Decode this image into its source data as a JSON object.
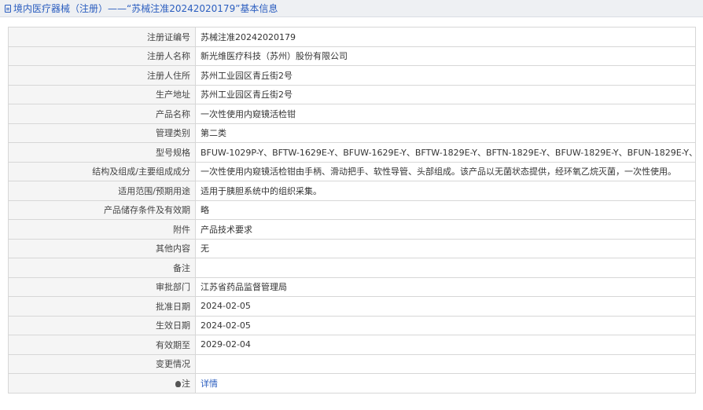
{
  "header": {
    "title": "境内医疗器械（注册）——“苏械注准20242020179”基本信息"
  },
  "rows": [
    {
      "label": "注册证编号",
      "value": "苏械注准20242020179"
    },
    {
      "label": "注册人名称",
      "value": "新光维医疗科技（苏州）股份有限公司"
    },
    {
      "label": "注册人住所",
      "value": "苏州工业园区青丘街2号"
    },
    {
      "label": "生产地址",
      "value": "苏州工业园区青丘街2号"
    },
    {
      "label": "产品名称",
      "value": "一次性使用内窥镜活检钳"
    },
    {
      "label": "管理类别",
      "value": "第二类"
    },
    {
      "label": "型号规格",
      "value": "BFUW-1029P-Y、BFTW-1629E-Y、BFUW-1629E-Y、BFTW-1829E-Y、BFTN-1829E-Y、BFUW-1829E-Y、BFUN-1829E-Y、"
    },
    {
      "label": "结构及组成/主要组成成分",
      "value": "一次性使用内窥镜活检钳由手柄、滑动把手、软性导管、头部组成。该产品以无菌状态提供，经环氧乙烷灭菌，一次性使用。"
    },
    {
      "label": "适用范围/预期用途",
      "value": "适用于胰胆系统中的组织采集。"
    },
    {
      "label": "产品储存条件及有效期",
      "value": "略"
    },
    {
      "label": "附件",
      "value": "产品技术要求"
    },
    {
      "label": "其他内容",
      "value": "无"
    },
    {
      "label": "备注",
      "value": ""
    },
    {
      "label": "审批部门",
      "value": "江苏省药品监督管理局"
    },
    {
      "label": "批准日期",
      "value": "2024-02-05"
    },
    {
      "label": "生效日期",
      "value": "2024-02-05"
    },
    {
      "label": "有效期至",
      "value": "2029-02-04"
    },
    {
      "label": "变更情况",
      "value": ""
    }
  ],
  "note": {
    "label": "注",
    "icon": "bulb-icon",
    "link_text": "详情"
  }
}
